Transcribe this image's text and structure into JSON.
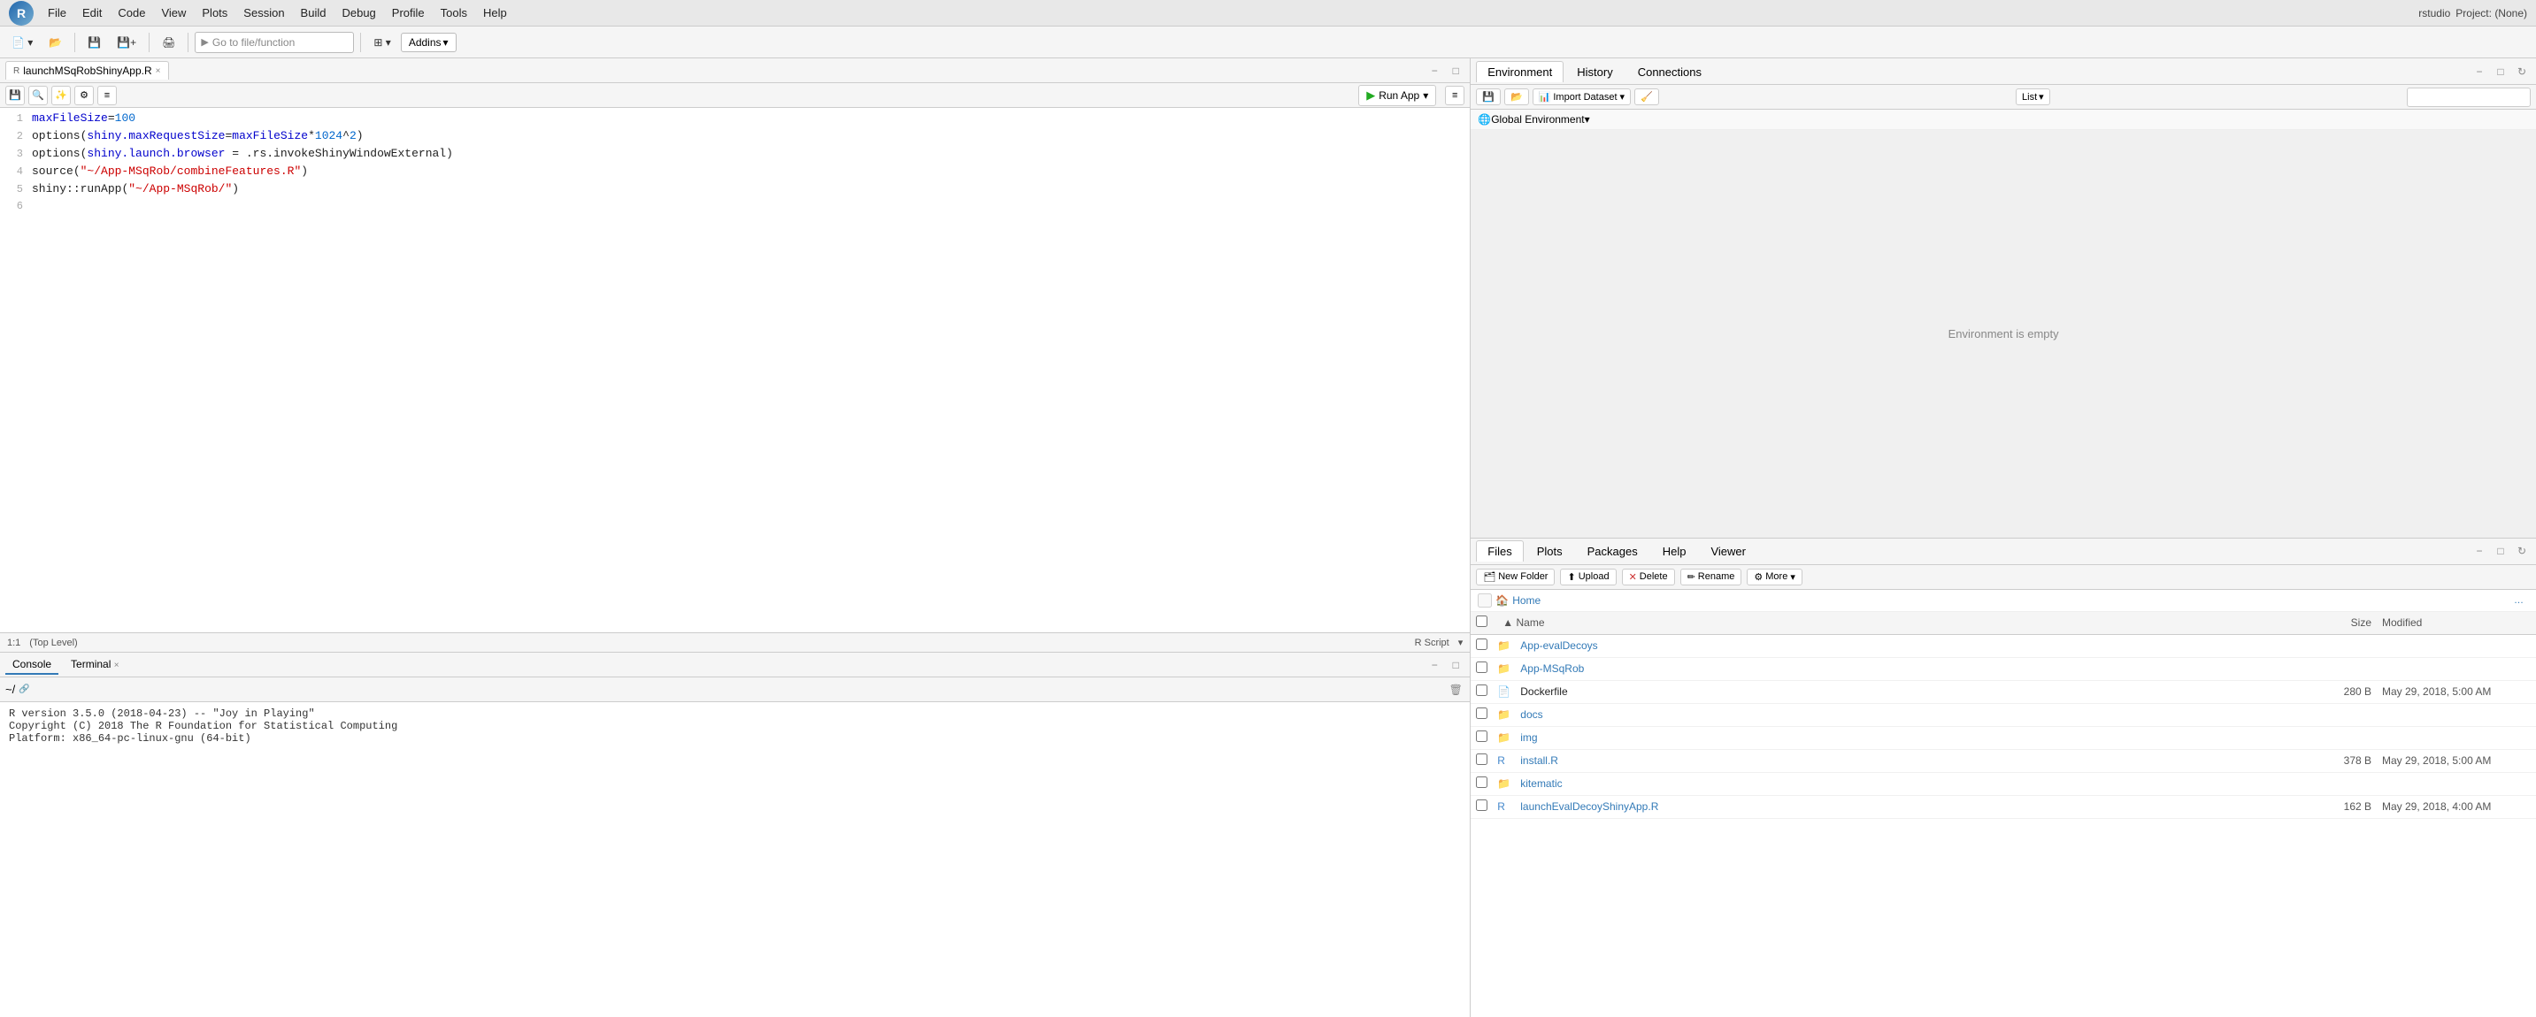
{
  "titlebar": {
    "app_name": "rstudio",
    "r_logo": "R",
    "project_label": "Project: (None)"
  },
  "menu": {
    "items": [
      "File",
      "Edit",
      "Code",
      "View",
      "Plots",
      "Session",
      "Build",
      "Debug",
      "Profile",
      "Tools",
      "Help"
    ]
  },
  "toolbar": {
    "goto_placeholder": "Go to file/function",
    "addins_label": "Addins"
  },
  "editor": {
    "tab_name": "launchMSqRobShinyApp.R",
    "run_app_label": "Run App",
    "lines": [
      {
        "num": "1",
        "code": "maxFileSize=100"
      },
      {
        "num": "2",
        "code": "options(shiny.maxRequestSize=maxFileSize*1024^2)"
      },
      {
        "num": "3",
        "code": "options(shiny.launch.browser = .rs.invokeShinyWindowExternal)"
      },
      {
        "num": "4",
        "code": "source(\"~/App-MSqRob/combineFeatures.R\")"
      },
      {
        "num": "5",
        "code": "shiny::runApp(\"~/App-MSqRob/\")"
      },
      {
        "num": "6",
        "code": ""
      }
    ],
    "status_position": "1:1",
    "status_level": "(Top Level)",
    "status_type": "R Script"
  },
  "console": {
    "tabs": [
      "Console",
      "Terminal"
    ],
    "terminal_close": "×",
    "prompt": "~/",
    "lines": [
      "R version 3.5.0 (2018-04-23) -- \"Joy in Playing\"",
      "Copyright (C) 2018 The R Foundation for Statistical Computing",
      "Platform: x86_64-pc-linux-gnu (64-bit)"
    ]
  },
  "environment": {
    "tabs": [
      "Environment",
      "History",
      "Connections"
    ],
    "active_tab": "Environment",
    "import_dataset_label": "Import Dataset",
    "list_label": "List",
    "global_env_label": "Global Environment",
    "empty_message": "Environment is empty",
    "search_placeholder": ""
  },
  "files": {
    "tabs": [
      "Files",
      "Plots",
      "Packages",
      "Help",
      "Viewer"
    ],
    "active_tab": "Files",
    "new_folder_label": "New Folder",
    "upload_label": "Upload",
    "delete_label": "Delete",
    "rename_label": "Rename",
    "more_label": "More",
    "home_label": "Home",
    "columns": {
      "name": "Name",
      "size": "Size",
      "modified": "Modified"
    },
    "rows": [
      {
        "type": "folder",
        "name": "App-evalDecoys",
        "size": "",
        "modified": ""
      },
      {
        "type": "folder",
        "name": "App-MSqRob",
        "size": "",
        "modified": ""
      },
      {
        "type": "file",
        "name": "Dockerfile",
        "size": "280 B",
        "modified": "May 29, 2018, 5:00 AM"
      },
      {
        "type": "folder",
        "name": "docs",
        "size": "",
        "modified": ""
      },
      {
        "type": "folder",
        "name": "img",
        "size": "",
        "modified": ""
      },
      {
        "type": "special",
        "name": "install.R",
        "size": "378 B",
        "modified": "May 29, 2018, 5:00 AM"
      },
      {
        "type": "folder",
        "name": "kitematic",
        "size": "",
        "modified": ""
      },
      {
        "type": "special",
        "name": "launchEvalDecoyShinyApp.R",
        "size": "162 B",
        "modified": "May 29, 2018, 4:00 AM"
      }
    ]
  }
}
